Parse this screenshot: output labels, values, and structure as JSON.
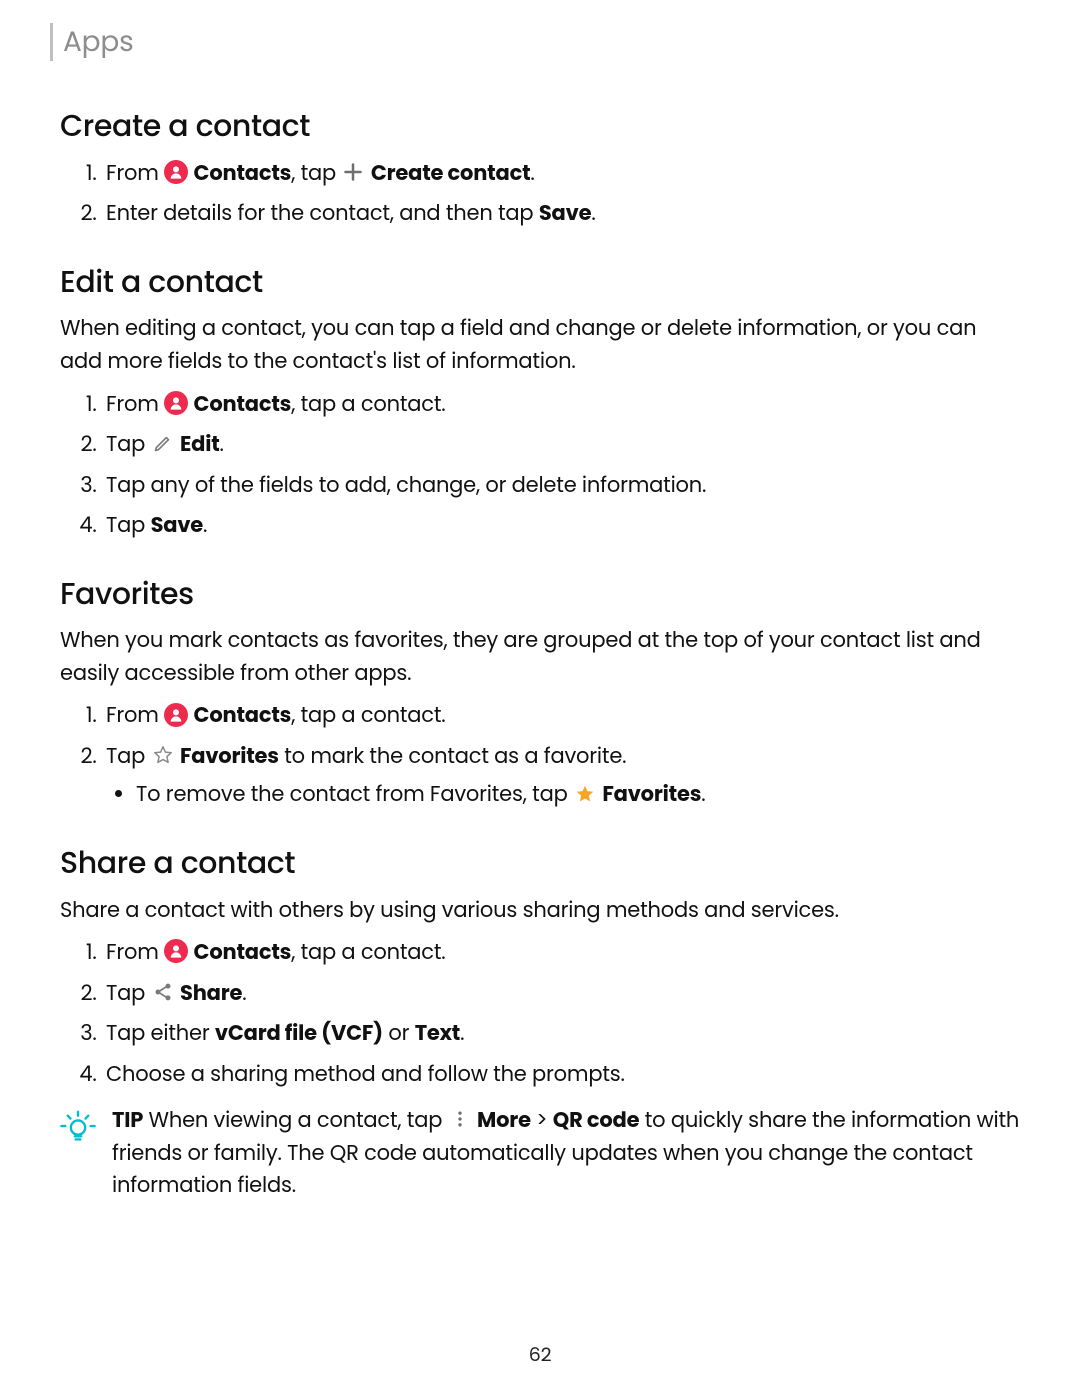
{
  "header": {
    "section": "Apps"
  },
  "create": {
    "title": "Create a contact",
    "step1_pre": "From ",
    "step1_contacts": "Contacts",
    "step1_tap": ", tap ",
    "step1_action": "Create contact",
    "step1_end": ".",
    "step2_pre": "Enter details for the contact, and then tap ",
    "step2_save": "Save",
    "step2_end": "."
  },
  "edit": {
    "title": "Edit a contact",
    "intro": "When editing a contact, you can tap a field and change or delete information, or you can add more fields to the contact's list of information.",
    "s1_pre": "From ",
    "s1_contacts": "Contacts",
    "s1_end": ", tap a contact.",
    "s2_pre": "Tap ",
    "s2_edit": "Edit",
    "s2_end": ".",
    "s3": "Tap any of the fields to add, change, or delete information.",
    "s4_pre": "Tap ",
    "s4_save": "Save",
    "s4_end": "."
  },
  "fav": {
    "title": "Favorites",
    "intro": "When you mark contacts as favorites, they are grouped at the top of your contact list and easily accessible from other apps.",
    "s1_pre": "From ",
    "s1_contacts": "Contacts",
    "s1_end": ", tap a contact.",
    "s2_pre": "Tap ",
    "s2_fav": "Favorites",
    "s2_end": " to mark the contact as a favorite.",
    "sub_pre": "To remove the contact from Favorites, tap ",
    "sub_fav": "Favorites",
    "sub_end": "."
  },
  "share": {
    "title": "Share a contact",
    "intro": "Share a contact with others by using various sharing methods and services.",
    "s1_pre": "From ",
    "s1_contacts": "Contacts",
    "s1_end": ", tap a contact.",
    "s2_pre": "Tap ",
    "s2_share": "Share",
    "s2_end": ".",
    "s3_pre": "Tap either ",
    "s3_vcf": "vCard file (VCF)",
    "s3_or": " or ",
    "s3_text": "Text",
    "s3_end": ".",
    "s4": "Choose a sharing method and follow the prompts."
  },
  "tip": {
    "label": "TIP",
    "pre": "  When viewing a contact, tap ",
    "more": "More",
    "gt": " > ",
    "qr": "QR code",
    "rest": " to quickly share the information with friends or family. The QR code automatically updates when you change the contact information fields."
  },
  "page": "62"
}
